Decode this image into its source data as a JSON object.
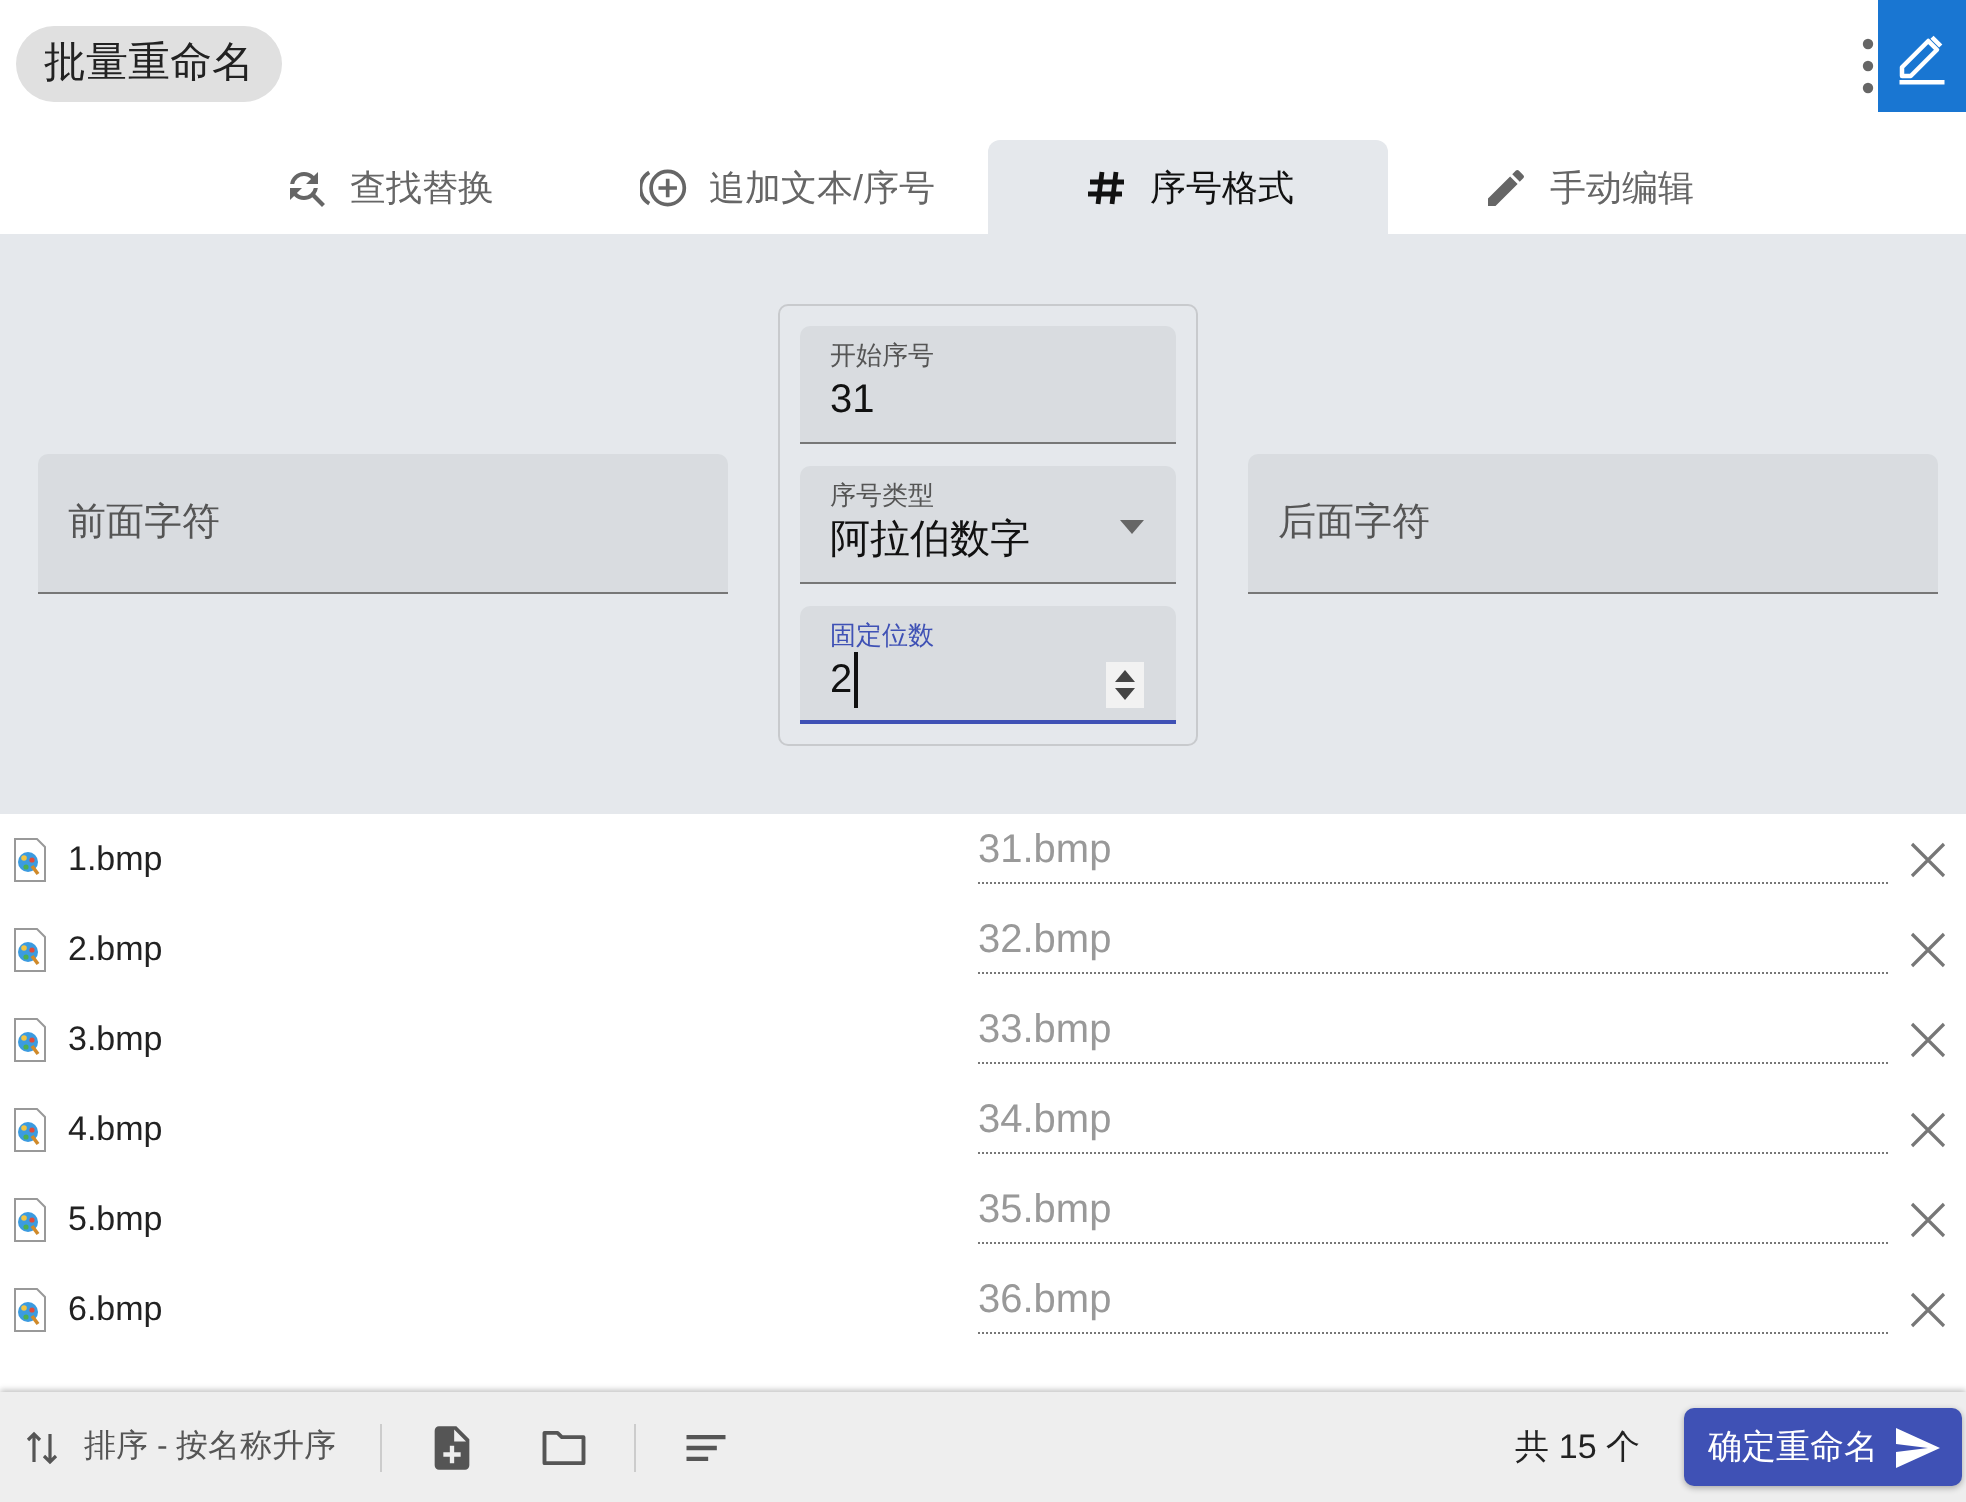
{
  "app": {
    "title": "批量重命名"
  },
  "tabs": [
    {
      "kind": "find-replace",
      "label": "查找替换",
      "selected": false
    },
    {
      "kind": "add-text",
      "label": "追加文本/序号",
      "selected": false
    },
    {
      "kind": "number-format",
      "label": "序号格式",
      "selected": true
    },
    {
      "kind": "manual-edit",
      "label": "手动编辑",
      "selected": false
    }
  ],
  "form": {
    "prefix": {
      "placeholder": "前面字符"
    },
    "group": [
      {
        "kind": "text",
        "label": "开始序号",
        "value": "31",
        "focused": false
      },
      {
        "kind": "select",
        "label": "序号类型",
        "value": "阿拉伯数字",
        "focused": false
      },
      {
        "kind": "number",
        "label": "固定位数",
        "value": "2",
        "focused": true
      }
    ],
    "suffix": {
      "placeholder": "后面字符"
    }
  },
  "files": [
    {
      "name": "1.bmp",
      "new_name": "31.bmp"
    },
    {
      "name": "2.bmp",
      "new_name": "32.bmp"
    },
    {
      "name": "3.bmp",
      "new_name": "33.bmp"
    },
    {
      "name": "4.bmp",
      "new_name": "34.bmp"
    },
    {
      "name": "5.bmp",
      "new_name": "35.bmp"
    },
    {
      "name": "6.bmp",
      "new_name": "36.bmp"
    }
  ],
  "bottom_bar": {
    "sort_label": "排序 - 按名称升序",
    "count": "共 15 个",
    "confirm_button": "确定重命名"
  }
}
